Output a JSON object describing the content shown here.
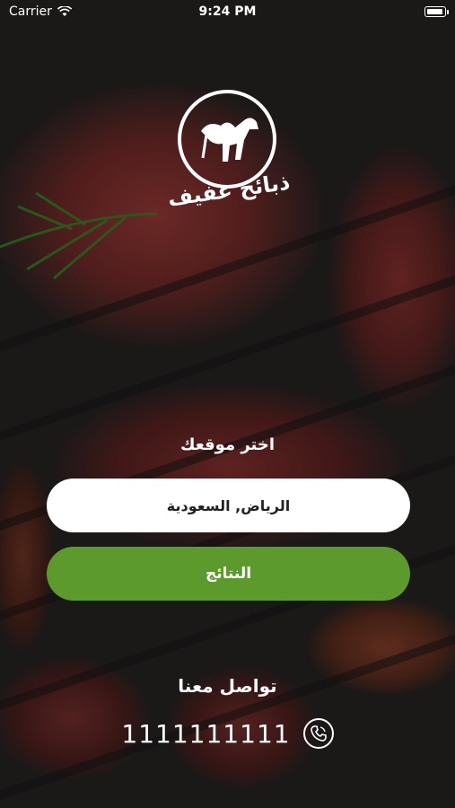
{
  "status_bar": {
    "carrier": "Carrier",
    "time": "9:24 PM"
  },
  "brand": {
    "name": "ذبائح عفيف"
  },
  "location": {
    "prompt": "اختر موقعك",
    "value": "الرياض, السعودية"
  },
  "actions": {
    "results_label": "النتائج"
  },
  "contact": {
    "heading": "تواصل معنا",
    "phone": "1111111111"
  },
  "colors": {
    "accent_green": "#5d9a2e",
    "field_bg": "#ffffff"
  },
  "icons": {
    "wifi": "wifi-icon",
    "battery": "battery-icon",
    "logo": "camel-logo-icon",
    "phone": "phone-icon"
  }
}
